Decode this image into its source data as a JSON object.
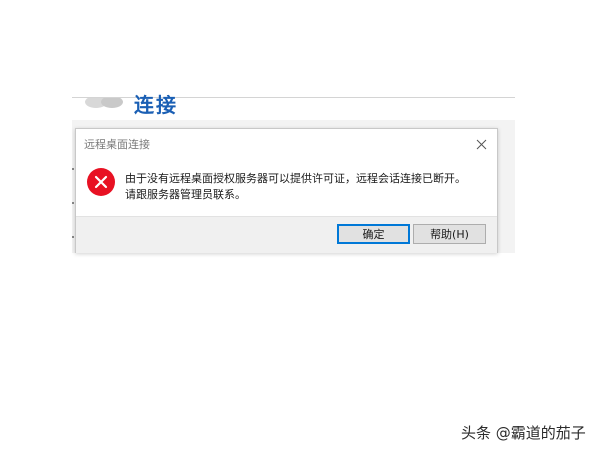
{
  "background_window": {
    "title": "连接"
  },
  "dialog": {
    "title": "远程桌面连接",
    "message_line1": "由于没有远程桌面授权服务器可以提供许可证，远程会话连接已断开。",
    "message_line2": "请跟服务器管理员联系。",
    "icon": "error-icon",
    "ok_label": "确定",
    "help_label": "帮助(H)",
    "close_icon": "close-icon"
  },
  "watermark": "头条 @霸道的茄子",
  "colors": {
    "error_red": "#e81123",
    "default_button_border": "#0078d7",
    "bg_title_blue": "#1a5fb4"
  }
}
